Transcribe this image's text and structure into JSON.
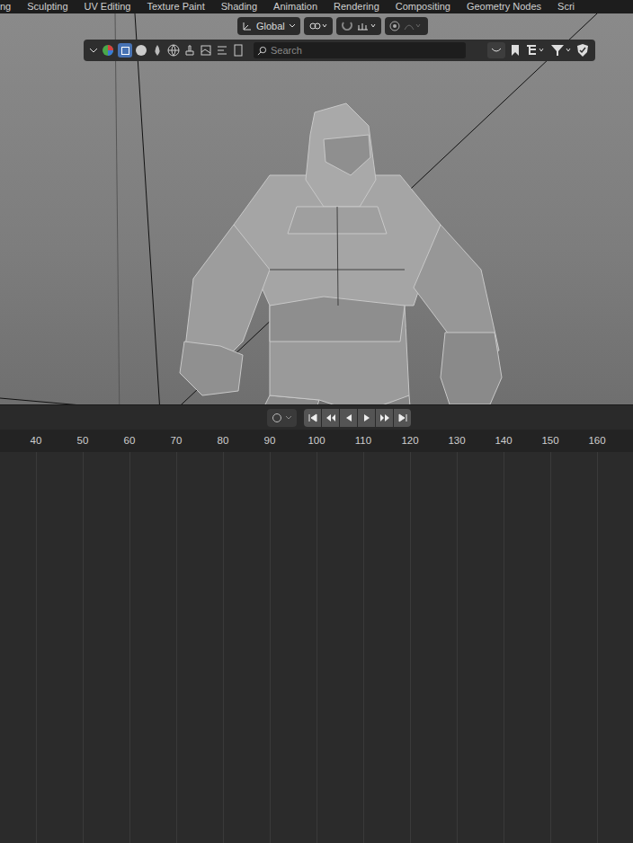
{
  "workspace_tabs": [
    {
      "label": "ng",
      "selected": false
    },
    {
      "label": "Sculpting",
      "selected": false
    },
    {
      "label": "UV Editing",
      "selected": false
    },
    {
      "label": "Texture Paint",
      "selected": false
    },
    {
      "label": "Shading",
      "selected": false
    },
    {
      "label": "Animation",
      "selected": false
    },
    {
      "label": "Rendering",
      "selected": false
    },
    {
      "label": "Compositing",
      "selected": false
    },
    {
      "label": "Geometry Nodes",
      "selected": false
    },
    {
      "label": "Scri",
      "selected": false
    }
  ],
  "viewport_header": {
    "orientation": "Global"
  },
  "outliner_toolbar": {
    "search": {
      "placeholder": "Search"
    }
  },
  "timeline": {
    "ticks": [
      "40",
      "50",
      "60",
      "70",
      "80",
      "90",
      "100",
      "110",
      "120",
      "130",
      "140",
      "150",
      "160"
    ]
  }
}
